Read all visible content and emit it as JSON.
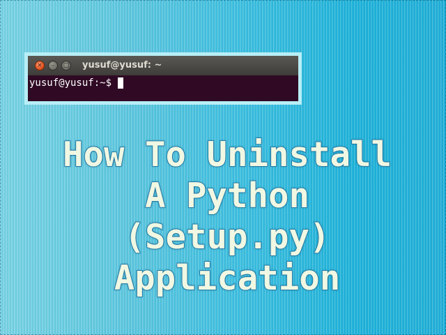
{
  "terminal": {
    "window_title": "yusuf@yusuf: ~",
    "prompt": "yusuf@yusuf:~$",
    "buttons": {
      "close_glyph": "×",
      "minimize_glyph": "–",
      "maximize_glyph": "□"
    },
    "colors": {
      "background": "#300a24",
      "titlebar": "#3e3d39",
      "text": "#ffffff"
    }
  },
  "headline": {
    "lines": [
      "How To Uninstall",
      "A Python",
      "(Setup.py)",
      "Application"
    ]
  },
  "colors": {
    "background_accent": "#3cbfe0",
    "headline_fill": "#f0f7e2",
    "headline_outline": "#2a86b3"
  }
}
